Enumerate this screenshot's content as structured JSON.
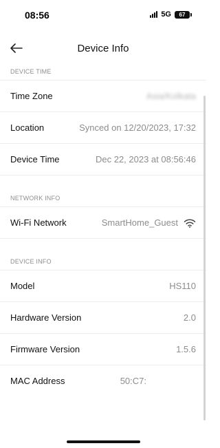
{
  "status_bar": {
    "time": "08:56",
    "network": "5G",
    "battery": "67"
  },
  "header": {
    "title": "Device Info"
  },
  "sections": {
    "device_time": {
      "title": "DEVICE TIME",
      "time_zone": {
        "label": "Time Zone",
        "value": "Asia/Kolkata"
      },
      "location": {
        "label": "Location",
        "value": "Synced on 12/20/2023, 17:32"
      },
      "device_time": {
        "label": "Device Time",
        "value": "Dec 22, 2023 at 08:56:46"
      }
    },
    "network_info": {
      "title": "NETWORK INFO",
      "wifi": {
        "label": "Wi-Fi Network",
        "value": "SmartHome_Guest",
        "icon": "wifi-icon"
      }
    },
    "device_info": {
      "title": "DEVICE INFO",
      "model": {
        "label": "Model",
        "value": "HS110"
      },
      "hardware": {
        "label": "Hardware Version",
        "value": "2.0"
      },
      "firmware": {
        "label": "Firmware Version",
        "value": "1.5.6"
      },
      "mac": {
        "label": "MAC Address",
        "value": "50:C7:"
      }
    }
  },
  "colors": {
    "text": "#111111",
    "secondary_text": "#8c8c8c",
    "section_header": "#8e8e93",
    "divider": "#ededed"
  }
}
